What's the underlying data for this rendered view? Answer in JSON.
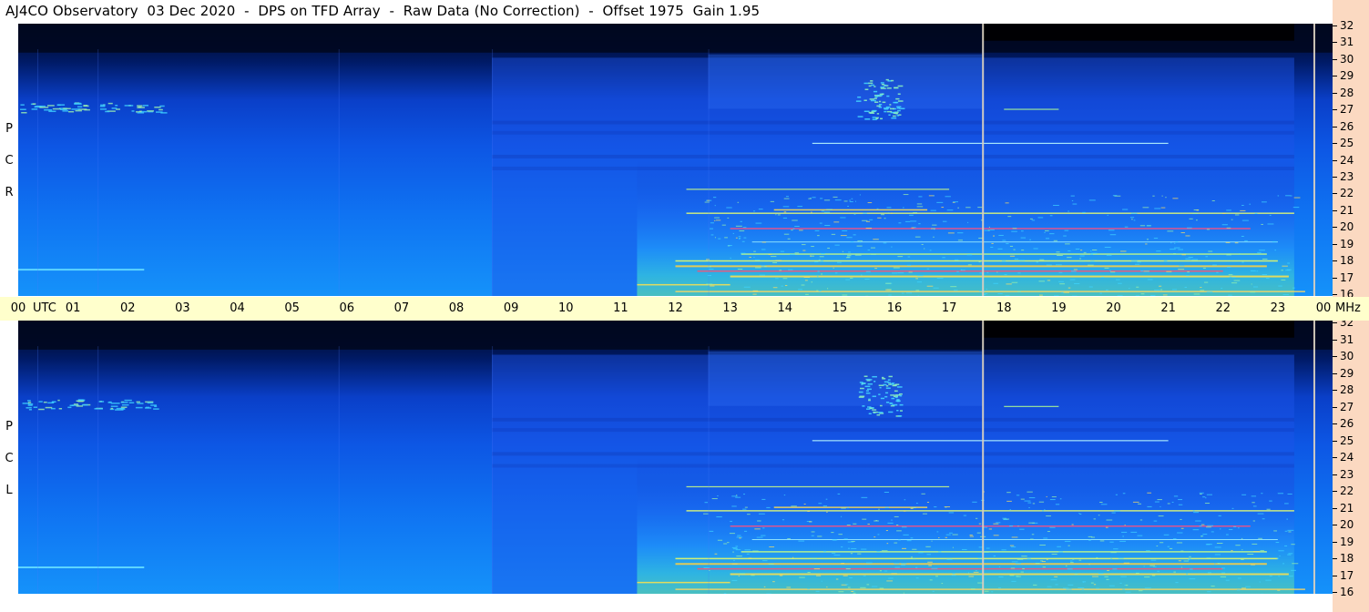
{
  "title": "AJ4CO Observatory  03 Dec 2020  -  DPS on TFD Array  -  Raw Data (No Correction)  -  Offset 1975  Gain 1.95",
  "chart_data": [
    {
      "type": "heatmap",
      "panel": "RCP",
      "label_letters": [
        "P",
        "C",
        "R"
      ],
      "x_ticks": [
        "00",
        "01",
        "02",
        "03",
        "04",
        "05",
        "06",
        "07",
        "08",
        "09",
        "10",
        "11",
        "12",
        "13",
        "14",
        "15",
        "16",
        "17",
        "18",
        "19",
        "20",
        "21",
        "22",
        "23",
        "00"
      ],
      "x_unit": "UTC",
      "x_range": [
        0,
        24
      ],
      "y_ticks": [
        "16",
        "17",
        "18",
        "19",
        "20",
        "21",
        "22",
        "23",
        "24",
        "25",
        "26",
        "27",
        "28",
        "29",
        "30",
        "31",
        "32"
      ],
      "y_unit": "MHz",
      "y_range": [
        16,
        32
      ],
      "markers_utc": [
        17.6,
        23.65
      ]
    },
    {
      "type": "heatmap",
      "panel": "LCP",
      "label_letters": [
        "P",
        "C",
        "L"
      ],
      "x_ticks": [
        "00",
        "01",
        "02",
        "03",
        "04",
        "05",
        "06",
        "07",
        "08",
        "09",
        "10",
        "11",
        "12",
        "13",
        "14",
        "15",
        "16",
        "17",
        "18",
        "19",
        "20",
        "21",
        "22",
        "23",
        "00"
      ],
      "x_unit": "UTC",
      "x_range": [
        0,
        24
      ],
      "y_ticks": [
        "16",
        "17",
        "18",
        "19",
        "20",
        "21",
        "22",
        "23",
        "24",
        "25",
        "26",
        "27",
        "28",
        "29",
        "30",
        "31",
        "32"
      ],
      "y_unit": "MHz",
      "y_range": [
        16,
        32
      ],
      "markers_utc": [
        17.6,
        23.65
      ]
    }
  ],
  "time_axis": {
    "utc_label": "UTC",
    "mhz_label": "MHz"
  },
  "colors": {
    "time_axis_bg": "#ffffcc",
    "freq_axis_bg": "#fbd9c1",
    "marker_line": "#d8d0c0"
  }
}
